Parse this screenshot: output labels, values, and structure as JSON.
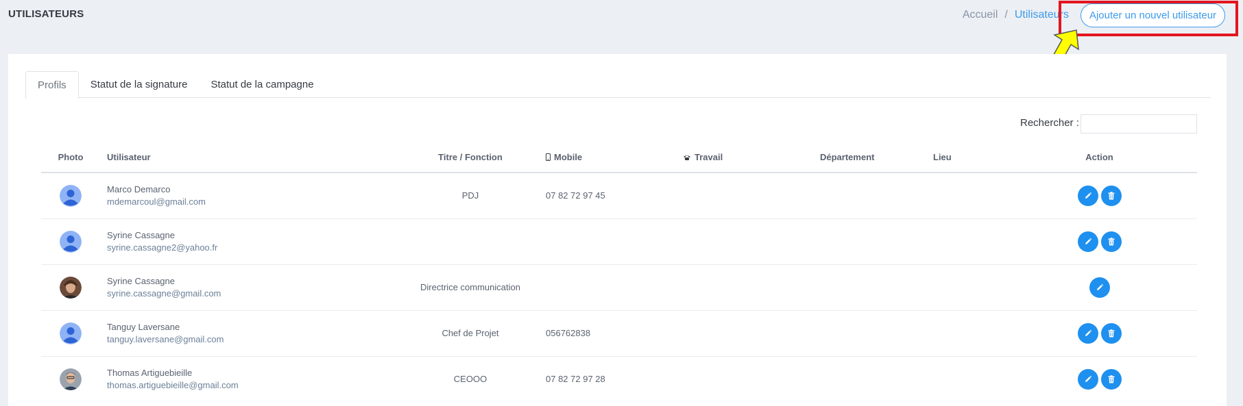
{
  "header": {
    "title": "UTILISATEURS",
    "breadcrumb": {
      "home": "Accueil",
      "separator": "/",
      "current": "Utilisateurs"
    },
    "add_button": "Ajouter un nouvel utilisateur"
  },
  "tabs": [
    {
      "label": "Profils",
      "active": true
    },
    {
      "label": "Statut de la signature",
      "active": false
    },
    {
      "label": "Statut de la campagne",
      "active": false
    }
  ],
  "search": {
    "label": "Rechercher :",
    "value": ""
  },
  "table": {
    "columns": {
      "photo": "Photo",
      "user": "Utilisateur",
      "title": "Titre / Fonction",
      "mobile": "Mobile",
      "work": "Travail",
      "department": "Département",
      "place": "Lieu",
      "action": "Action"
    },
    "rows": [
      {
        "name": "Marco Demarco",
        "email": "mdemarcoul@gmail.com",
        "title": "PDJ",
        "mobile": "07 82 72 97 45",
        "work": "",
        "department": "",
        "place": "",
        "avatar": "default-user-icon",
        "can_delete": true
      },
      {
        "name": "Syrine Cassagne",
        "email": "syrine.cassagne2@yahoo.fr",
        "title": "",
        "mobile": "",
        "work": "",
        "department": "",
        "place": "",
        "avatar": "default-user-icon",
        "can_delete": true
      },
      {
        "name": "Syrine Cassagne",
        "email": "syrine.cassagne@gmail.com",
        "title": "Directrice communication",
        "mobile": "",
        "work": "",
        "department": "",
        "place": "",
        "avatar": "photo-woman",
        "can_delete": false
      },
      {
        "name": "Tanguy Laversane",
        "email": "tanguy.laversane@gmail.com",
        "title": "Chef de Projet",
        "mobile": "056762838",
        "work": "",
        "department": "",
        "place": "",
        "avatar": "default-user-icon",
        "can_delete": true
      },
      {
        "name": "Thomas Artiguebieille",
        "email": "thomas.artiguebieille@gmail.com",
        "title": "CEOOO",
        "mobile": "07 82 72 97 28",
        "work": "",
        "department": "",
        "place": "",
        "avatar": "photo-man",
        "can_delete": true
      }
    ]
  },
  "colors": {
    "accent": "#1e90ef",
    "highlight_box": "#e3151f",
    "arrow": "#ffff00"
  }
}
